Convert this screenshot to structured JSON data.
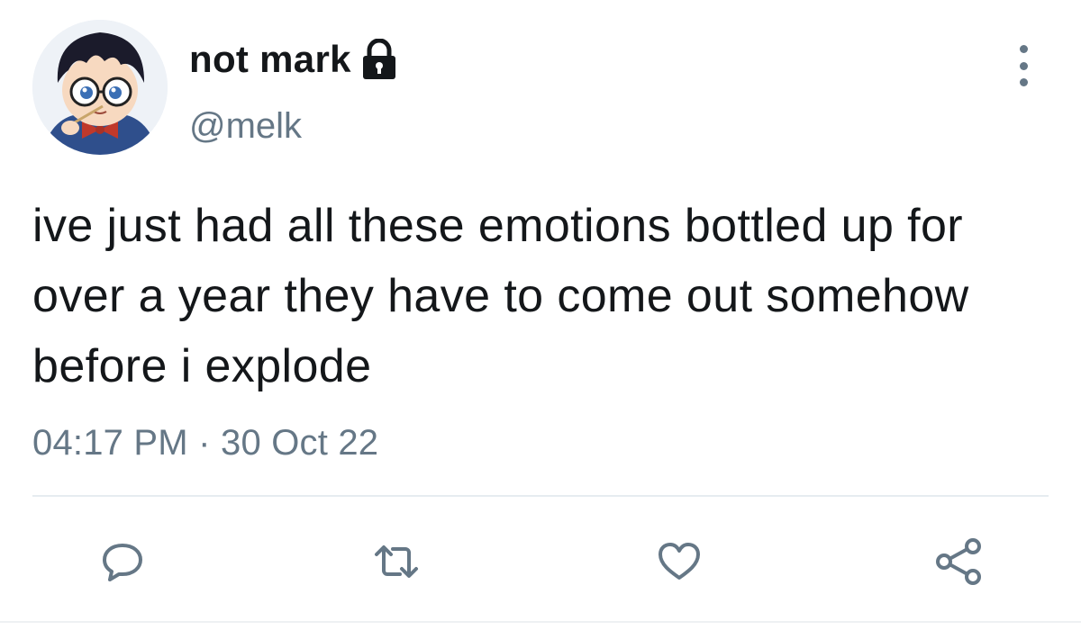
{
  "user": {
    "display_name": "not mark",
    "handle": "@melk",
    "avatar_icon": "anime-character-avatar",
    "protected_icon": "lock-icon"
  },
  "tweet": {
    "text": "ive just had all these emotions bottled up for over a year they have to come out somehow before i explode",
    "time": "04:17 PM",
    "separator": "·",
    "date": "30 Oct 22"
  },
  "actions": {
    "reply_icon": "reply-icon",
    "retweet_icon": "retweet-icon",
    "like_icon": "heart-icon",
    "share_icon": "share-icon",
    "more_icon": "more-options-icon"
  },
  "colors": {
    "text": "#14171a",
    "secondary": "#657786",
    "divider": "#e6ecf0"
  }
}
